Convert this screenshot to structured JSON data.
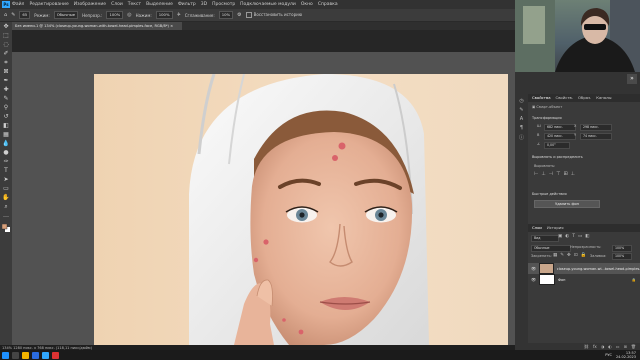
{
  "menu": {
    "logo": "Ps",
    "items": [
      "Файл",
      "Редактирование",
      "Изображение",
      "Слои",
      "Текст",
      "Выделение",
      "Фильтр",
      "3D",
      "Просмотр",
      "Подключаемые модули",
      "Окно",
      "Справка"
    ]
  },
  "options": {
    "size": "65",
    "mode_label": "Режим:",
    "mode": "Обычные",
    "opacity_label": "Непрозр.:",
    "opacity": "100%",
    "flow_label": "Нажим:",
    "flow": "100%",
    "smooth_label": "Сглаживание:",
    "smooth": "10%",
    "sample_label": "Восстановить историю"
  },
  "document": {
    "tab_title": "Без имени-1 @ 134% (closeup-young-woman-with-towel-head-pimples-face, RGB/8*)"
  },
  "status": {
    "zoom": "134%",
    "size": "1280 пикс. x 768 пикс. (118,11 пикс/дюйм)"
  },
  "tray": {
    "lang": "РУС",
    "time": "13:57",
    "date": "24.02.2023"
  },
  "properties": {
    "tabs": [
      "Свойства",
      "Свойств.",
      "Образ.",
      "Каналы"
    ],
    "doc_label": "Смарт-объект",
    "transform_title": "Трансформация",
    "w_label": "Ш",
    "w": "682 пикс.",
    "x_label": "X",
    "x": "298 пикс.",
    "h_label": "В",
    "h": "420 пикс.",
    "y_label": "Y",
    "y": "74 пикс.",
    "angle": "0,00°",
    "align_title": "Выровнять и распределить",
    "align_label": "Выровнять:",
    "quick_title": "Быстрые действия",
    "remove_bg_button": "Удалить фон"
  },
  "layers": {
    "tabs": [
      "Слои",
      "История"
    ],
    "filter_label": "Вид",
    "blend": "Обычные",
    "opacity_label": "Непрозрачность:",
    "opacity": "100%",
    "lock_label": "Закрепить:",
    "fill_label": "Заливка:",
    "fill": "100%",
    "items": [
      {
        "name": "closeup-young-woman-wi...towel-head-pimples-face"
      },
      {
        "name": "Фон"
      }
    ]
  },
  "colors": {
    "accent": "#31a8ff",
    "panel": "#3a3a3a",
    "canvas": "#525252",
    "skin": "#e7b59b",
    "pimple": "#d9636a"
  }
}
